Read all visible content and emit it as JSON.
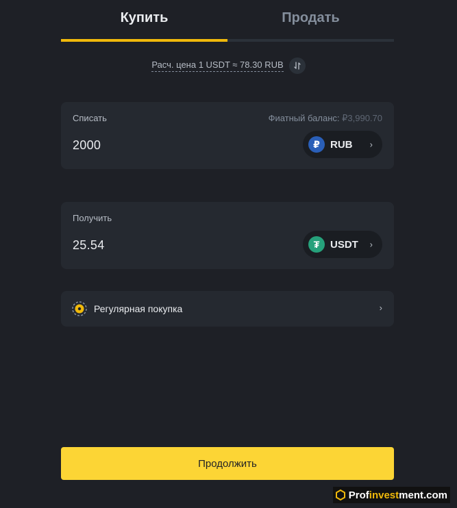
{
  "tabs": [
    {
      "label": "Купить",
      "active": true
    },
    {
      "label": "Продать",
      "active": false
    }
  ],
  "rate": {
    "text": "Расч. цена 1 USDT ≈ 78.30 RUB",
    "swap_icon": "swap-vertical-icon"
  },
  "spend": {
    "label": "Списать",
    "balance_label": "Фиатный баланс:",
    "balance_value": "₽3,990.70",
    "value": "2000",
    "currency": "RUB",
    "currency_symbol": "₽",
    "currency_icon": "ruble-coin-icon"
  },
  "receive": {
    "label": "Получить",
    "value": "25.54",
    "currency": "USDT",
    "currency_symbol": "₮",
    "currency_icon": "tether-coin-icon"
  },
  "recurring": {
    "label": "Регулярная покупка",
    "icon": "recurring-buy-icon"
  },
  "continue_label": "Продолжить",
  "watermark": {
    "prefix": "Prof",
    "highlight": "invest",
    "suffix": "ment.com"
  },
  "colors": {
    "background": "#1e2026",
    "card": "#252930",
    "accent": "#f0b90b",
    "button": "#fcd535"
  }
}
